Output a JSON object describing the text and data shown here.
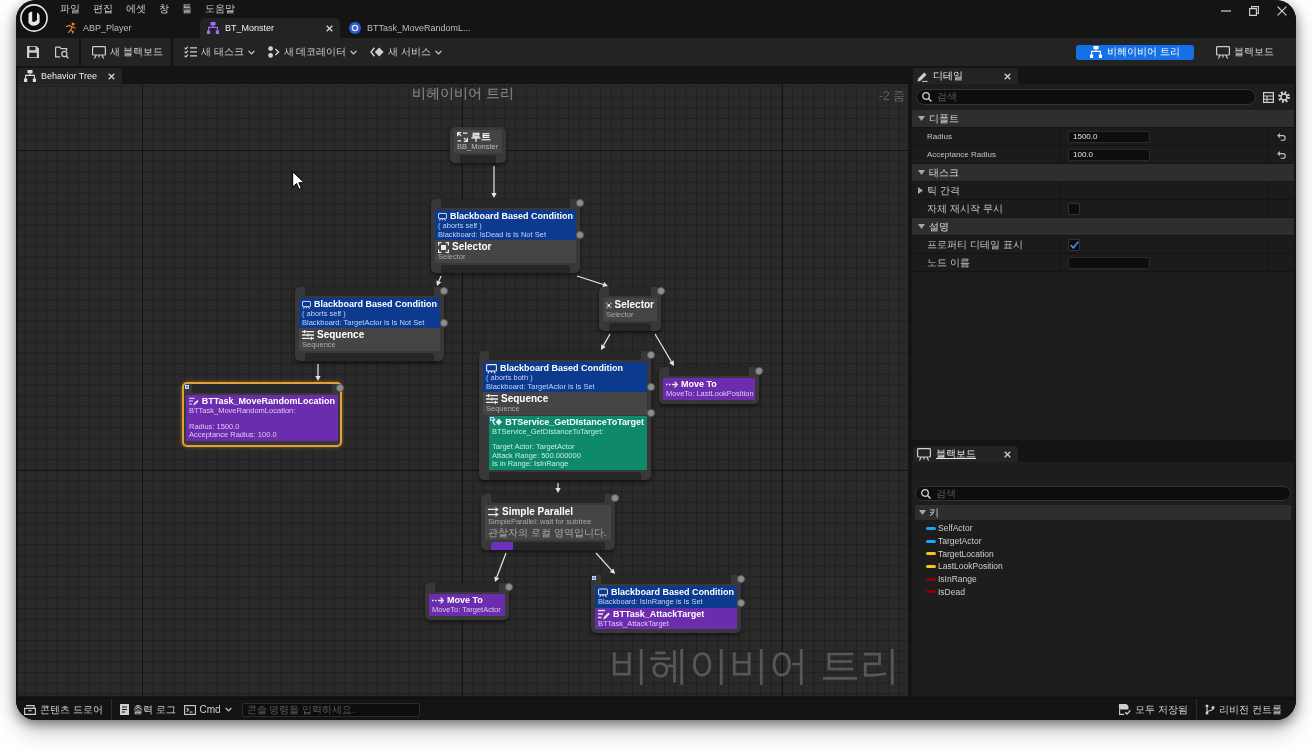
{
  "window": {
    "menu": [
      "파일",
      "편집",
      "에셋",
      "창",
      "툴",
      "도움말"
    ],
    "tabs": [
      {
        "label": "ABP_Player",
        "kind": "animation",
        "selected": false
      },
      {
        "label": "BT_Monster",
        "kind": "tree",
        "selected": true
      },
      {
        "label": "BTTask_MoveRandomL...",
        "kind": "blueprint",
        "selected": false
      }
    ]
  },
  "toolbar": {
    "actions": [
      {
        "label": "새 블랙보드",
        "kind": "blackboard",
        "dropdown": false
      },
      {
        "label": "새 태스크",
        "kind": "task",
        "dropdown": true
      },
      {
        "label": "새 데코레이터",
        "kind": "decorator",
        "dropdown": true
      },
      {
        "label": "새 서비스",
        "kind": "service",
        "dropdown": true
      }
    ],
    "modes": [
      {
        "label": "비헤이비어 트리",
        "kind": "tree",
        "selected": true
      },
      {
        "label": "블랙보드",
        "kind": "blackboard",
        "selected": false
      }
    ]
  },
  "graph": {
    "tab": {
      "label": "Behavior Tree"
    },
    "title": "비헤이비어 트리",
    "zoom": "-2 줌",
    "corner_label": "비헤이비어 트리",
    "tree": {
      "kind": "root",
      "title": "루트",
      "lines": [
        "BB_Monster"
      ],
      "selected": false,
      "marker": false,
      "children": [
        {
          "kind": "selector",
          "title": "Selector",
          "lines": [
            "Selector"
          ],
          "selected": false,
          "marker": false,
          "decorators": [
            {
              "title": "Blackboard Based Condition",
              "lines": [
                "( aborts self )",
                "Blackboard: IsDead is Is Not Set"
              ]
            }
          ],
          "children": [
            {
              "kind": "sequence",
              "title": "Sequence",
              "lines": [
                "Sequence"
              ],
              "selected": false,
              "marker": false,
              "decorators": [
                {
                  "title": "Blackboard Based Condition",
                  "lines": [
                    "( aborts self )",
                    "Blackboard: TargetActor is Is Not Set"
                  ]
                }
              ],
              "children": [
                {
                  "kind": "task",
                  "title": "BTTask_MoveRandomLocation",
                  "lines": [
                    "BTTask_MoveRandomLocation:"
                  ],
                  "details": [
                    "Radius: 1500.0",
                    "Acceptance Radius: 100.0"
                  ],
                  "selected": true,
                  "marker": true
                }
              ]
            },
            {
              "kind": "selector",
              "title": "Selector",
              "lines": [
                "Selector"
              ],
              "selected": false,
              "marker": false,
              "children": [
                {
                  "kind": "sequence",
                  "title": "Sequence",
                  "lines": [
                    "Sequence"
                  ],
                  "selected": false,
                  "marker": false,
                  "decorators": [
                    {
                      "title": "Blackboard Based Condition",
                      "lines": [
                        "( aborts both )",
                        "Blackboard: TargetActor is Is Set"
                      ]
                    }
                  ],
                  "services": [
                    {
                      "title": "BTService_GetDIstanceToTarget",
                      "lines": [
                        "BTService_GetDIstanceToTarget:"
                      ],
                      "details": [
                        "Target Actor: TargetActor",
                        "Attack Range: 500.000000",
                        "Is in Range: IsInRange"
                      ],
                      "marker": true
                    }
                  ],
                  "children": [
                    {
                      "kind": "parallel",
                      "title": "Simple Parallel",
                      "lines": [
                        "SimpleParallel: wait for subtree",
                        "관찰자의 로컬 영역입니다."
                      ],
                      "selected": false,
                      "marker": false,
                      "children": [
                        {
                          "kind": "move",
                          "title": "Move To",
                          "lines": [
                            "MoveTo: TargetActor"
                          ],
                          "selected": false,
                          "marker": false
                        },
                        {
                          "kind": "task",
                          "title": "BTTask_AttackTarget",
                          "lines": [
                            "BTTask_AttackTarget"
                          ],
                          "selected": false,
                          "marker": true,
                          "decorators": [
                            {
                              "title": "Blackboard Based Condition",
                              "lines": [
                                "Blackboard: IsInRange is Is Set"
                              ]
                            }
                          ]
                        }
                      ]
                    }
                  ]
                },
                {
                  "kind": "move",
                  "title": "Move To",
                  "lines": [
                    "MoveTo: LastLookPosition"
                  ],
                  "selected": false,
                  "marker": false
                }
              ]
            }
          ]
        }
      ]
    }
  },
  "details": {
    "tab": {
      "label": "디테일"
    },
    "search": {
      "placeholder": "검색"
    },
    "sections": [
      {
        "title": "디폴트",
        "expanded": true,
        "rows": [
          {
            "kind": "number",
            "label": "Radius",
            "value": "1500.0",
            "resettable": true
          },
          {
            "kind": "number",
            "label": "Acceptance Radius",
            "value": "100.0",
            "resettable": true
          }
        ]
      },
      {
        "title": "태스크",
        "expanded": true,
        "rows": [
          {
            "kind": "group",
            "label": "틱 간격",
            "expanded": false,
            "resettable": false
          },
          {
            "kind": "checkbox",
            "label": "자체 재시작 무시",
            "checked": false,
            "resettable": false
          }
        ]
      },
      {
        "title": "설명",
        "expanded": true,
        "rows": [
          {
            "kind": "checkbox",
            "label": "프로퍼티 디테일 표시",
            "checked": true,
            "resettable": false
          },
          {
            "kind": "text",
            "label": "노드 이름",
            "resettable": false
          }
        ]
      }
    ]
  },
  "blackboard": {
    "tab": {
      "label": "블랙보드"
    },
    "search": {
      "placeholder": "검색"
    },
    "category": {
      "title": "키",
      "expanded": true
    },
    "keys": [
      {
        "name": "SelfActor",
        "color": "#1fa3f3"
      },
      {
        "name": "TargetActor",
        "color": "#1fa3f3"
      },
      {
        "name": "TargetLocation",
        "color": "#f5c41c"
      },
      {
        "name": "LastLookPosition",
        "color": "#f5c41c"
      },
      {
        "name": "IsInRange",
        "color": "#8e0000"
      },
      {
        "name": "IsDead",
        "color": "#8e0000"
      }
    ]
  },
  "status_bar": {
    "left": [
      {
        "label": "콘텐츠 드로어",
        "kind": "drawer"
      },
      {
        "label": "출력 로그",
        "kind": "log"
      },
      {
        "label": "Cmd",
        "kind": "command"
      }
    ],
    "console": {
      "placeholder": "콘솔 명령을 입력하세요."
    },
    "right": [
      {
        "label": "모두 저장됨",
        "kind": "save"
      },
      {
        "label": "리비전 컨트롤",
        "kind": "revision"
      }
    ]
  }
}
